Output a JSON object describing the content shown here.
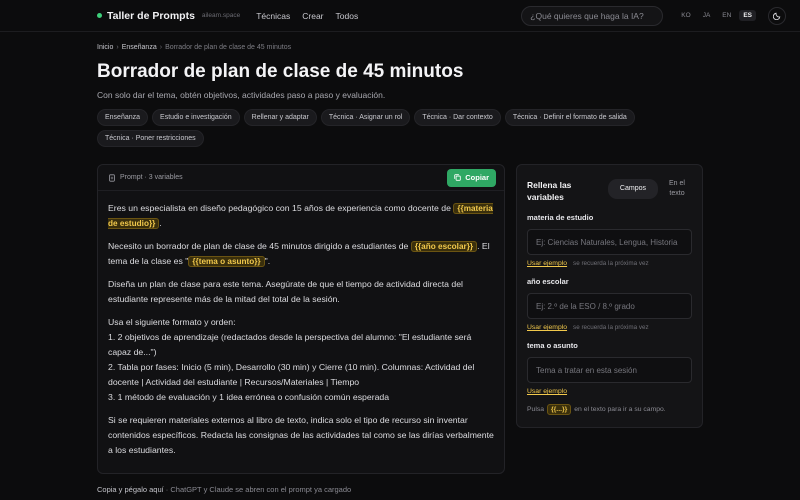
{
  "header": {
    "brand": "Taller de Prompts",
    "domain": "aileam.space",
    "nav": [
      "Técnicas",
      "Crear",
      "Todos"
    ],
    "search_placeholder": "¿Qué quieres que haga la IA?",
    "languages": [
      "KO",
      "JA",
      "EN",
      "ES"
    ],
    "active_language": "ES"
  },
  "breadcrumb": {
    "items": [
      "Inicio",
      "Enseñanza"
    ],
    "separator": "›",
    "current": "Borrador de plan de clase de 45 minutos"
  },
  "page": {
    "title": "Borrador de plan de clase de 45 minutos",
    "subtitle": "Con solo dar el tema, obtén objetivos, actividades paso a paso y evaluación."
  },
  "tags": [
    "Enseñanza",
    "Estudio e investigación",
    "Rellenar y adaptar",
    "Técnica · Asignar un rol",
    "Técnica · Dar contexto",
    "Técnica · Definir el formato de salida",
    "Técnica · Poner restricciones"
  ],
  "prompt": {
    "label": "Prompt · 3 variables",
    "copy_label": "Copiar",
    "p1_a": "Eres un especialista en diseño pedagógico con 15 años de experiencia como docente de ",
    "var_materia": "{{materia de estudio}}",
    "p1_b": ".",
    "p2_a": "Necesito un borrador de plan de clase de 45 minutos dirigido a estudiantes de ",
    "var_anio": "{{año escolar}}",
    "p2_b": ". El tema de la clase es \"",
    "var_tema": "{{tema o asunto}}",
    "p2_c": "\".",
    "p3": "Diseña un plan de clase para este tema. Asegúrate de que el tiempo de actividad directa del estudiante represente más de la mitad del total de la sesión.",
    "p4_lines": [
      "Usa el siguiente formato y orden:",
      "1. 2 objetivos de aprendizaje (redactados desde la perspectiva del alumno: \"El estudiante será capaz de...\")",
      "2. Tabla por fases: Inicio (5 min), Desarrollo (30 min) y Cierre (10 min). Columnas: Actividad del docente | Actividad del estudiante | Recursos/Materiales | Tiempo",
      "3. 1 método de evaluación y 1 idea errónea o confusión común esperada"
    ],
    "p5": "Si se requieren materiales externos al libro de texto, indica solo el tipo de recurso sin inventar contenidos específicos. Redacta las consignas de las actividades tal como se las dirías verbalmente a los estudiantes."
  },
  "bottom_note": {
    "strong": "Copia y pégalo aquí",
    "rest": " · ChatGPT y Claude se abren con el prompt ya cargado"
  },
  "variables_panel": {
    "title": "Rellena las variables",
    "toggle": [
      "Campos",
      "En el texto"
    ],
    "active_toggle": "Campos",
    "fields": [
      {
        "label": "materia de estudio",
        "placeholder": "Ej: Ciencias Naturales, Lengua, Historia",
        "example": "Usar ejemplo",
        "note": "se recuerda la próxima vez"
      },
      {
        "label": "año escolar",
        "placeholder": "Ej: 2.º de la ESO / 8.º grado",
        "example": "Usar ejemplo",
        "note": "se recuerda la próxima vez"
      },
      {
        "label": "tema o asunto",
        "placeholder": "Tema a tratar en esta sesión",
        "example": "Usar ejemplo",
        "note": ""
      }
    ],
    "hint_a": "Pulsa",
    "hint_var": "{{...}}",
    "hint_b": "en el texto para ir a su campo."
  },
  "colors": {
    "accent_green": "#2fa864",
    "variable_yellow": "#f2c94c",
    "background": "#0c0c0d"
  }
}
